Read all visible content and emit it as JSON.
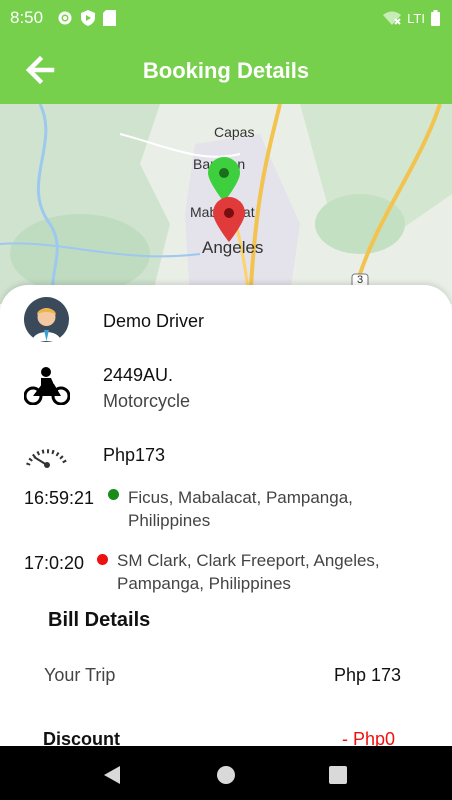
{
  "status_bar": {
    "time": "8:50",
    "network": "LTI"
  },
  "header": {
    "title": "Booking Details"
  },
  "map": {
    "labels": [
      "Capas",
      "Bamban",
      "Mabalacat",
      "Angeles",
      "3"
    ]
  },
  "driver": {
    "name": "Demo Driver"
  },
  "vehicle": {
    "plate": "2449AU.",
    "type": "Motorcycle"
  },
  "fare": {
    "amount": "Php173"
  },
  "trip": {
    "pickup": {
      "time": "16:59:21",
      "address_line1": "Ficus, Mabalacat, Pampanga,",
      "address_line2": "Philippines",
      "dot_color": "#1a8a1a"
    },
    "dropoff": {
      "time": "17:0:20",
      "address_line1": "SM Clark, Clark Freeport, Angeles,",
      "address_line2": "Pampanga, Philippines",
      "dot_color": "#ee1111"
    }
  },
  "bill": {
    "heading": "Bill Details",
    "your_trip_label": "Your Trip",
    "your_trip_value": "Php 173",
    "discount_label": "Discount",
    "discount_value": "- Php0"
  },
  "colors": {
    "accent": "#76d04b",
    "discount": "#ee1111"
  }
}
